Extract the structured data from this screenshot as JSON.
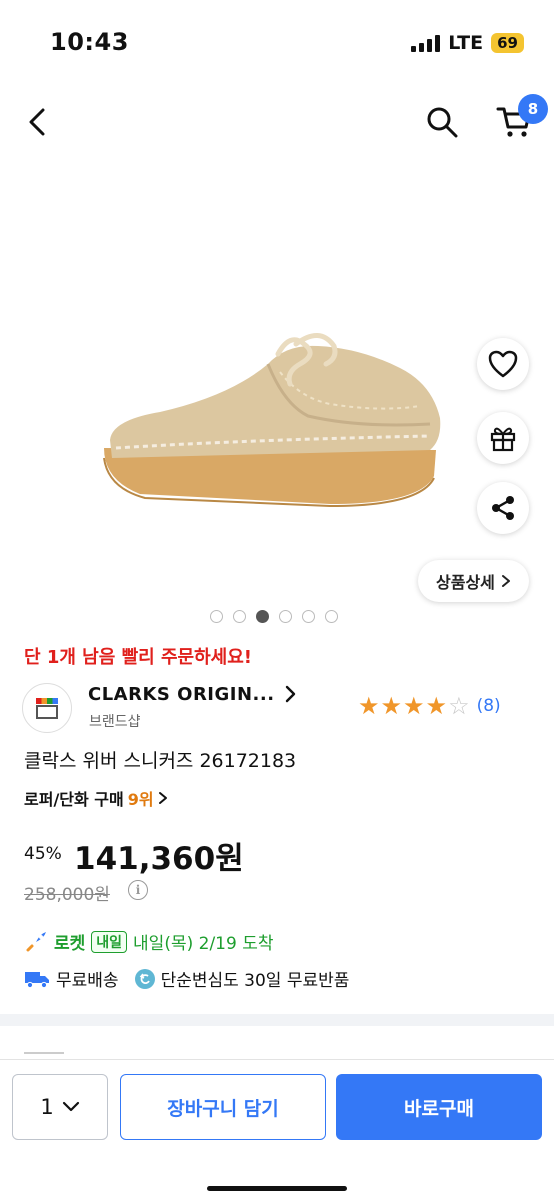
{
  "status_bar": {
    "time": "10:43",
    "network": "LTE",
    "battery": "69"
  },
  "nav": {
    "back_icon": "chevron-left-icon",
    "search_icon": "search-icon",
    "cart_icon": "cart-icon",
    "cart_badge": "8"
  },
  "gallery": {
    "total_images": 6,
    "active_index": 3,
    "detail_button_label": "상품상세",
    "actions": [
      "heart-icon",
      "gift-icon",
      "share-icon"
    ]
  },
  "product": {
    "stock_alert": "단 1개 남음 빨리 주문하세요!",
    "brand_name": "CLARKS ORIGIN...",
    "brand_sub": "브랜드샵",
    "rating_stars": 4,
    "review_count": "(8)",
    "title": "클락스 위버 스니커즈 26172183",
    "rank_category": "로퍼/단화 구매",
    "rank_value": "9위",
    "discount": "45%",
    "price": "141,360원",
    "original_price": "258,000원"
  },
  "delivery": {
    "rocket_label": "로켓",
    "tomorrow_badge": "내일",
    "arrival": "내일(목) 2/19 도착",
    "free_shipping": "무료배송",
    "return_policy": "단순변심도 30일 무료반품"
  },
  "bottom_bar": {
    "quantity": "1",
    "cart_button": "장바구니 담기",
    "buy_button": "바로구매"
  },
  "colors": {
    "accent": "#3478f6",
    "alert": "#e0201c",
    "rocket_green": "#1e9e2e",
    "star": "#f0962a"
  }
}
